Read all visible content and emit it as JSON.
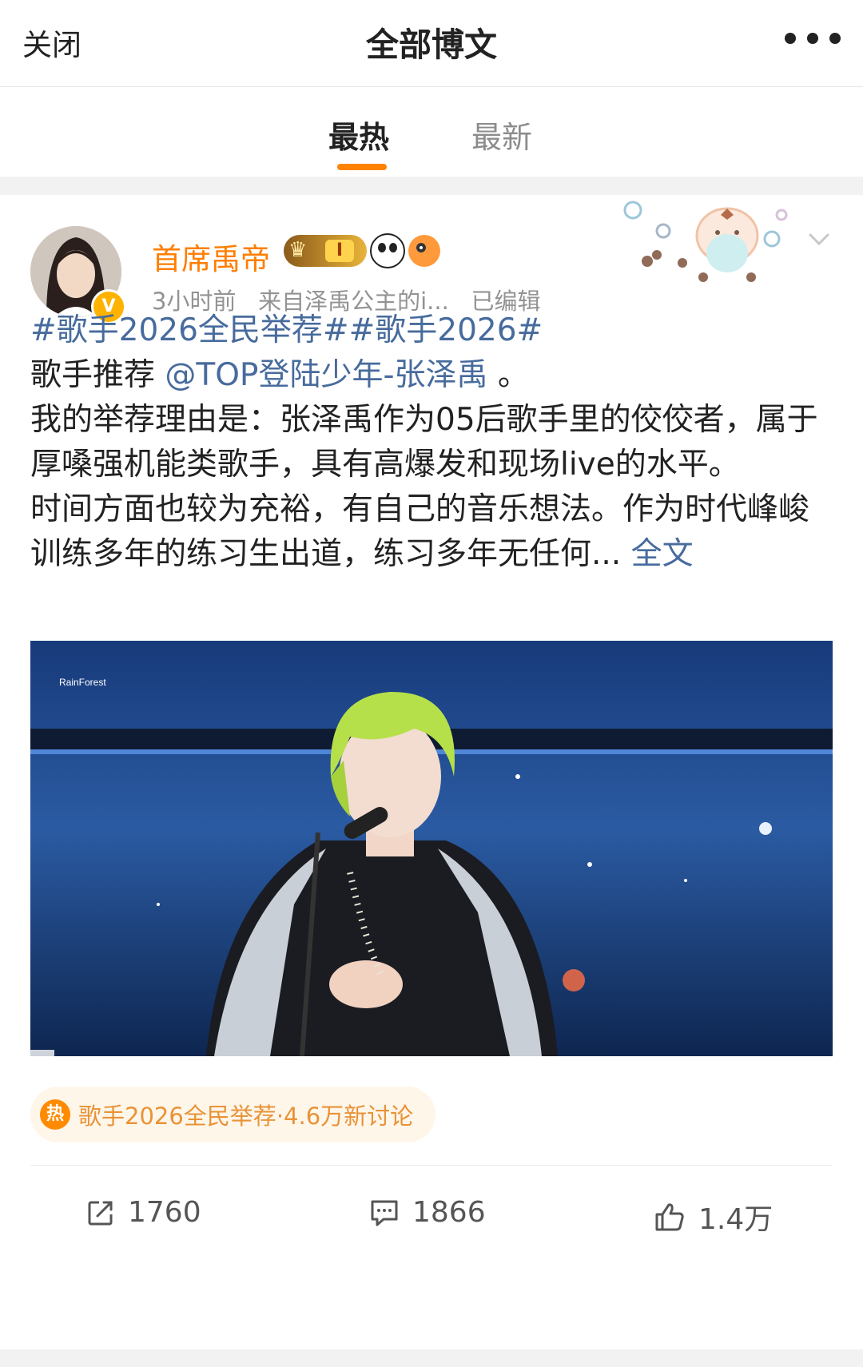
{
  "header": {
    "close_label": "关闭",
    "title": "全部博文"
  },
  "tabs": [
    {
      "label": "最热",
      "active": true
    },
    {
      "label": "最新",
      "active": false
    }
  ],
  "post": {
    "user": {
      "name": "首席禹帝",
      "verify_badge": "V",
      "crown_level": "I"
    },
    "meta": {
      "time": "3小时前",
      "source_prefix": "来自",
      "source_name": "泽禹公主的i...",
      "edited": "已编辑"
    },
    "body": {
      "hashtags": "#歌手2026全民举荐##歌手2026#",
      "line2_prefix": "歌手推荐 ",
      "mention": "@TOP登陆少年-张泽禹",
      "line2_suffix": " 。",
      "para1": "我的举荐理由是：张泽禹作为05后歌手里的佼佼者，属于厚嗓强机能类歌手，具有高爆发和现场live的水平。",
      "para2": "时间方面也较为充裕，有自己的音乐想法。作为时代峰峻训练多年的练习生出道，练习多年无任何...",
      "full_link": " 全文"
    },
    "image_watermark": "RainForest",
    "topic": {
      "icon_text": "热",
      "name": "歌手2026全民举荐",
      "separator": "·",
      "stat": "4.6万新讨论"
    },
    "actions": {
      "repost": "1760",
      "comment": "1866",
      "like": "1.4万"
    }
  },
  "colors": {
    "accent_orange": "#ff8200",
    "username_orange": "#ff7e00",
    "link_blue": "#476b9d"
  }
}
